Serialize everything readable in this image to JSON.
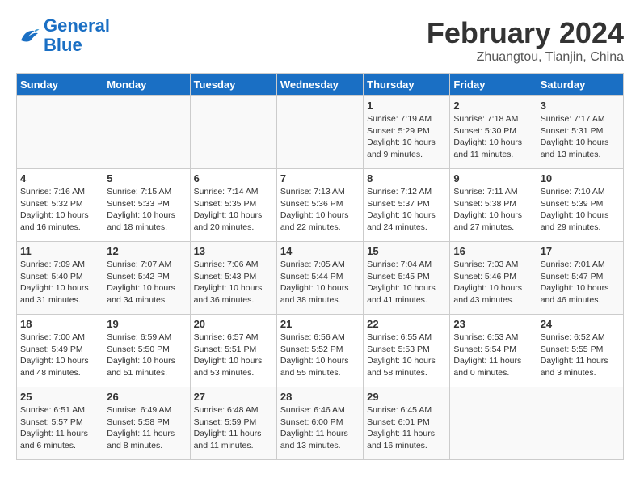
{
  "header": {
    "logo_line1": "General",
    "logo_line2": "Blue",
    "month_year": "February 2024",
    "location": "Zhuangtou, Tianjin, China"
  },
  "weekdays": [
    "Sunday",
    "Monday",
    "Tuesday",
    "Wednesday",
    "Thursday",
    "Friday",
    "Saturday"
  ],
  "weeks": [
    [
      {
        "day": "",
        "info": ""
      },
      {
        "day": "",
        "info": ""
      },
      {
        "day": "",
        "info": ""
      },
      {
        "day": "",
        "info": ""
      },
      {
        "day": "1",
        "info": "Sunrise: 7:19 AM\nSunset: 5:29 PM\nDaylight: 10 hours\nand 9 minutes."
      },
      {
        "day": "2",
        "info": "Sunrise: 7:18 AM\nSunset: 5:30 PM\nDaylight: 10 hours\nand 11 minutes."
      },
      {
        "day": "3",
        "info": "Sunrise: 7:17 AM\nSunset: 5:31 PM\nDaylight: 10 hours\nand 13 minutes."
      }
    ],
    [
      {
        "day": "4",
        "info": "Sunrise: 7:16 AM\nSunset: 5:32 PM\nDaylight: 10 hours\nand 16 minutes."
      },
      {
        "day": "5",
        "info": "Sunrise: 7:15 AM\nSunset: 5:33 PM\nDaylight: 10 hours\nand 18 minutes."
      },
      {
        "day": "6",
        "info": "Sunrise: 7:14 AM\nSunset: 5:35 PM\nDaylight: 10 hours\nand 20 minutes."
      },
      {
        "day": "7",
        "info": "Sunrise: 7:13 AM\nSunset: 5:36 PM\nDaylight: 10 hours\nand 22 minutes."
      },
      {
        "day": "8",
        "info": "Sunrise: 7:12 AM\nSunset: 5:37 PM\nDaylight: 10 hours\nand 24 minutes."
      },
      {
        "day": "9",
        "info": "Sunrise: 7:11 AM\nSunset: 5:38 PM\nDaylight: 10 hours\nand 27 minutes."
      },
      {
        "day": "10",
        "info": "Sunrise: 7:10 AM\nSunset: 5:39 PM\nDaylight: 10 hours\nand 29 minutes."
      }
    ],
    [
      {
        "day": "11",
        "info": "Sunrise: 7:09 AM\nSunset: 5:40 PM\nDaylight: 10 hours\nand 31 minutes."
      },
      {
        "day": "12",
        "info": "Sunrise: 7:07 AM\nSunset: 5:42 PM\nDaylight: 10 hours\nand 34 minutes."
      },
      {
        "day": "13",
        "info": "Sunrise: 7:06 AM\nSunset: 5:43 PM\nDaylight: 10 hours\nand 36 minutes."
      },
      {
        "day": "14",
        "info": "Sunrise: 7:05 AM\nSunset: 5:44 PM\nDaylight: 10 hours\nand 38 minutes."
      },
      {
        "day": "15",
        "info": "Sunrise: 7:04 AM\nSunset: 5:45 PM\nDaylight: 10 hours\nand 41 minutes."
      },
      {
        "day": "16",
        "info": "Sunrise: 7:03 AM\nSunset: 5:46 PM\nDaylight: 10 hours\nand 43 minutes."
      },
      {
        "day": "17",
        "info": "Sunrise: 7:01 AM\nSunset: 5:47 PM\nDaylight: 10 hours\nand 46 minutes."
      }
    ],
    [
      {
        "day": "18",
        "info": "Sunrise: 7:00 AM\nSunset: 5:49 PM\nDaylight: 10 hours\nand 48 minutes."
      },
      {
        "day": "19",
        "info": "Sunrise: 6:59 AM\nSunset: 5:50 PM\nDaylight: 10 hours\nand 51 minutes."
      },
      {
        "day": "20",
        "info": "Sunrise: 6:57 AM\nSunset: 5:51 PM\nDaylight: 10 hours\nand 53 minutes."
      },
      {
        "day": "21",
        "info": "Sunrise: 6:56 AM\nSunset: 5:52 PM\nDaylight: 10 hours\nand 55 minutes."
      },
      {
        "day": "22",
        "info": "Sunrise: 6:55 AM\nSunset: 5:53 PM\nDaylight: 10 hours\nand 58 minutes."
      },
      {
        "day": "23",
        "info": "Sunrise: 6:53 AM\nSunset: 5:54 PM\nDaylight: 11 hours\nand 0 minutes."
      },
      {
        "day": "24",
        "info": "Sunrise: 6:52 AM\nSunset: 5:55 PM\nDaylight: 11 hours\nand 3 minutes."
      }
    ],
    [
      {
        "day": "25",
        "info": "Sunrise: 6:51 AM\nSunset: 5:57 PM\nDaylight: 11 hours\nand 6 minutes."
      },
      {
        "day": "26",
        "info": "Sunrise: 6:49 AM\nSunset: 5:58 PM\nDaylight: 11 hours\nand 8 minutes."
      },
      {
        "day": "27",
        "info": "Sunrise: 6:48 AM\nSunset: 5:59 PM\nDaylight: 11 hours\nand 11 minutes."
      },
      {
        "day": "28",
        "info": "Sunrise: 6:46 AM\nSunset: 6:00 PM\nDaylight: 11 hours\nand 13 minutes."
      },
      {
        "day": "29",
        "info": "Sunrise: 6:45 AM\nSunset: 6:01 PM\nDaylight: 11 hours\nand 16 minutes."
      },
      {
        "day": "",
        "info": ""
      },
      {
        "day": "",
        "info": ""
      }
    ]
  ]
}
